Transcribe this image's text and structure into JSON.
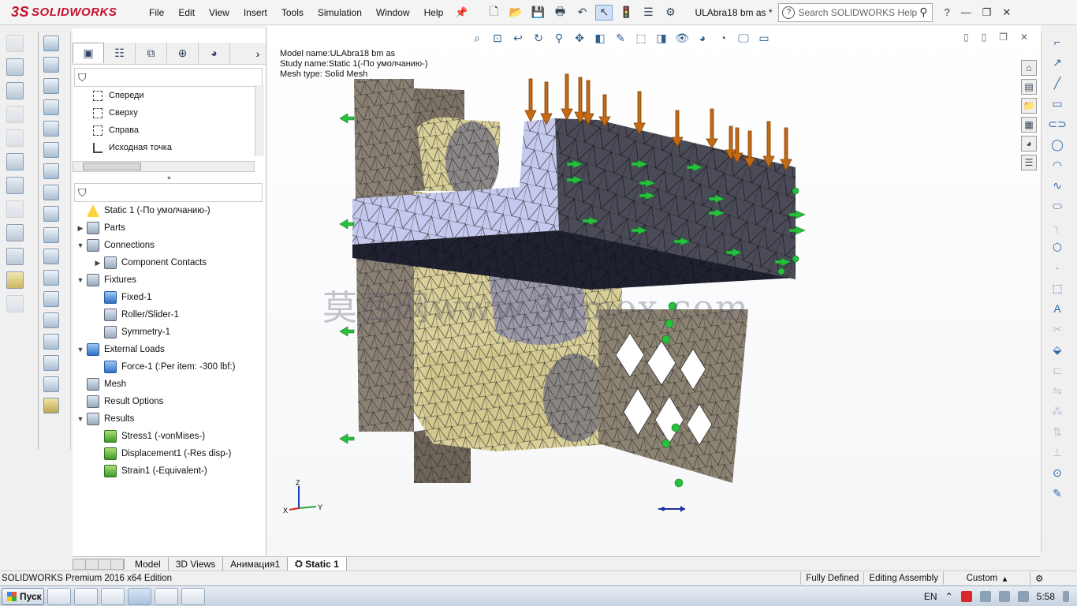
{
  "app": {
    "logo_prefix": "3S",
    "logo_text": "SOLIDWORKS",
    "document_title": "ULAbra18 bm as *"
  },
  "menu": [
    "File",
    "Edit",
    "View",
    "Insert",
    "Tools",
    "Simulation",
    "Window",
    "Help"
  ],
  "search": {
    "placeholder": "Search SOLIDWORKS Help"
  },
  "feature_tree_top": [
    {
      "label": "Спереди"
    },
    {
      "label": "Сверху"
    },
    {
      "label": "Справа"
    },
    {
      "label": "Исходная точка"
    }
  ],
  "study_tree": [
    {
      "label": "Static 1 (-По умолчанию-)",
      "level": 0,
      "expand": "",
      "icon": "warning-icon"
    },
    {
      "label": "Parts",
      "level": 0,
      "expand": "▶",
      "icon": "parts-icon"
    },
    {
      "label": "Connections",
      "level": 0,
      "expand": "▼",
      "icon": "connections-icon"
    },
    {
      "label": "Component Contacts",
      "level": 1,
      "expand": "▶",
      "icon": "contacts-icon"
    },
    {
      "label": "Fixtures",
      "level": 0,
      "expand": "▼",
      "icon": "fixtures-icon"
    },
    {
      "label": "Fixed-1",
      "level": 1,
      "expand": "",
      "icon": "fixed-icon"
    },
    {
      "label": "Roller/Slider-1",
      "level": 1,
      "expand": "",
      "icon": "roller-icon"
    },
    {
      "label": "Symmetry-1",
      "level": 1,
      "expand": "",
      "icon": "symmetry-icon"
    },
    {
      "label": "External Loads",
      "level": 0,
      "expand": "▼",
      "icon": "external-loads-icon"
    },
    {
      "label": "Force-1 (:Per item: -300 lbf:)",
      "level": 1,
      "expand": "",
      "icon": "force-icon"
    },
    {
      "label": "Mesh",
      "level": 0,
      "expand": "",
      "icon": "mesh-icon"
    },
    {
      "label": "Result Options",
      "level": 0,
      "expand": "",
      "icon": "result-options-icon"
    },
    {
      "label": "Results",
      "level": 0,
      "expand": "▼",
      "icon": "results-folder-icon"
    },
    {
      "label": "Stress1 (-vonMises-)",
      "level": 1,
      "expand": "",
      "icon": "stress-plot-icon"
    },
    {
      "label": "Displacement1 (-Res disp-)",
      "level": 1,
      "expand": "",
      "icon": "displacement-plot-icon"
    },
    {
      "label": "Strain1 (-Equivalent-)",
      "level": 1,
      "expand": "",
      "icon": "strain-plot-icon"
    }
  ],
  "viewport": {
    "info_model": "Model name:ULAbra18 bm as",
    "info_study": "Study name:Static 1(-По умолчанию-)",
    "info_mesh": "Mesh type: Solid Mesh",
    "watermark": "莫西网www.3dmox.com",
    "triad_z": "Z",
    "triad_y": "Y",
    "triad_x": "X"
  },
  "bottom_tabs": [
    "Model",
    "3D Views",
    "Анимация1",
    "Static 1"
  ],
  "status": {
    "edition": "SOLIDWORKS Premium 2016 x64 Edition",
    "state": "Fully Defined",
    "mode": "Editing Assembly",
    "units": "Custom"
  },
  "taskbar": {
    "start_label": "Пуск",
    "language": "EN",
    "clock": "5:58"
  },
  "colors": {
    "brand": "#c8102e",
    "mesh_edge": "#1e1e1e",
    "beige": "#d9cf98",
    "steel": "#8a8074",
    "lavender": "#c6c9ee",
    "dark_block": "#4a4b57",
    "force_arrow": "#c46a14",
    "fixture_arrow": "#27c23d"
  }
}
